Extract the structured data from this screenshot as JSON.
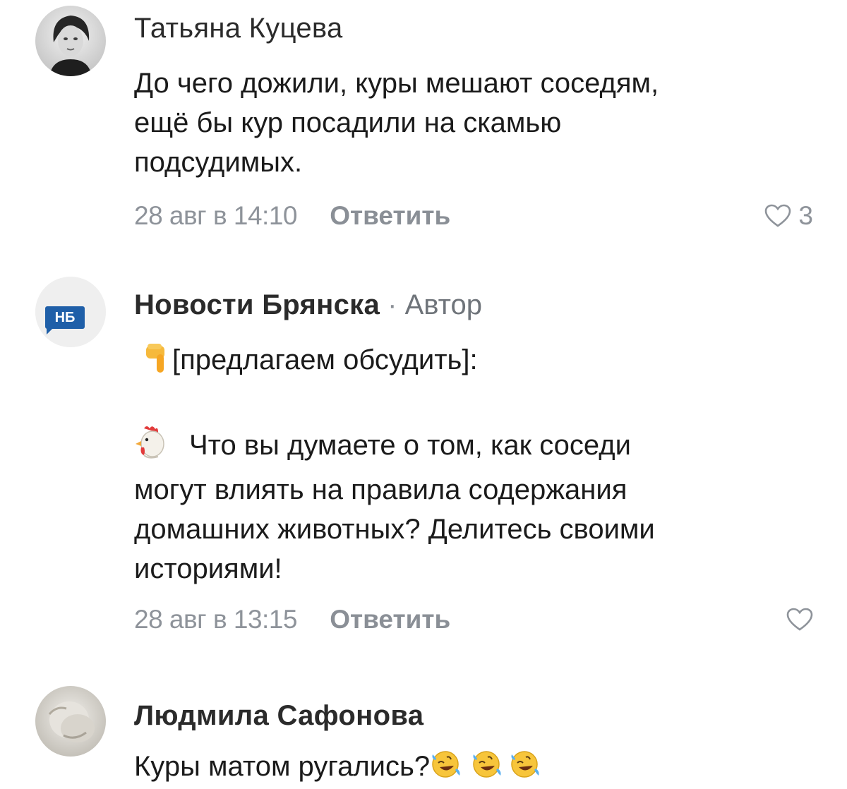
{
  "comments": [
    {
      "author": "Татьяна Куцева",
      "role": "",
      "text_lines": [
        "До чего дожили, куры мешают соседям,",
        "ещё бы кур посадили на скамью",
        "подсудимых."
      ],
      "date": "28 авг в 14:10",
      "reply_label": "Ответить",
      "likes": "3",
      "avatar_icon": "portrait-photo"
    },
    {
      "author": "Новости Брянска",
      "separator": "·",
      "role": "Автор",
      "avatar_text": "НБ",
      "line1_emoji": "point-down-icon",
      "line1": "[предлагаем обсудить]:",
      "line2_emoji": "rooster-icon",
      "text_lines": [
        "Что вы думаете о том, как соседи",
        "могут влиять на правила содержания",
        "домашних животных? Делитесь своими",
        "историями!"
      ],
      "date": "28 авг в 13:15",
      "reply_label": "Ответить",
      "likes": "",
      "colors": {
        "badge": "#1f5fa8"
      }
    },
    {
      "author": "Людмила Сафонова",
      "role": "",
      "text": "Куры матом ругались?",
      "emoji_trailing": [
        "rofl-emoji",
        "rofl-emoji",
        "rofl-emoji"
      ],
      "avatar_icon": "photo-avatar"
    }
  ],
  "colors": {
    "text": "#1b1b1b",
    "meta": "#8e939a",
    "accent_badge": "#1f5fa8"
  }
}
